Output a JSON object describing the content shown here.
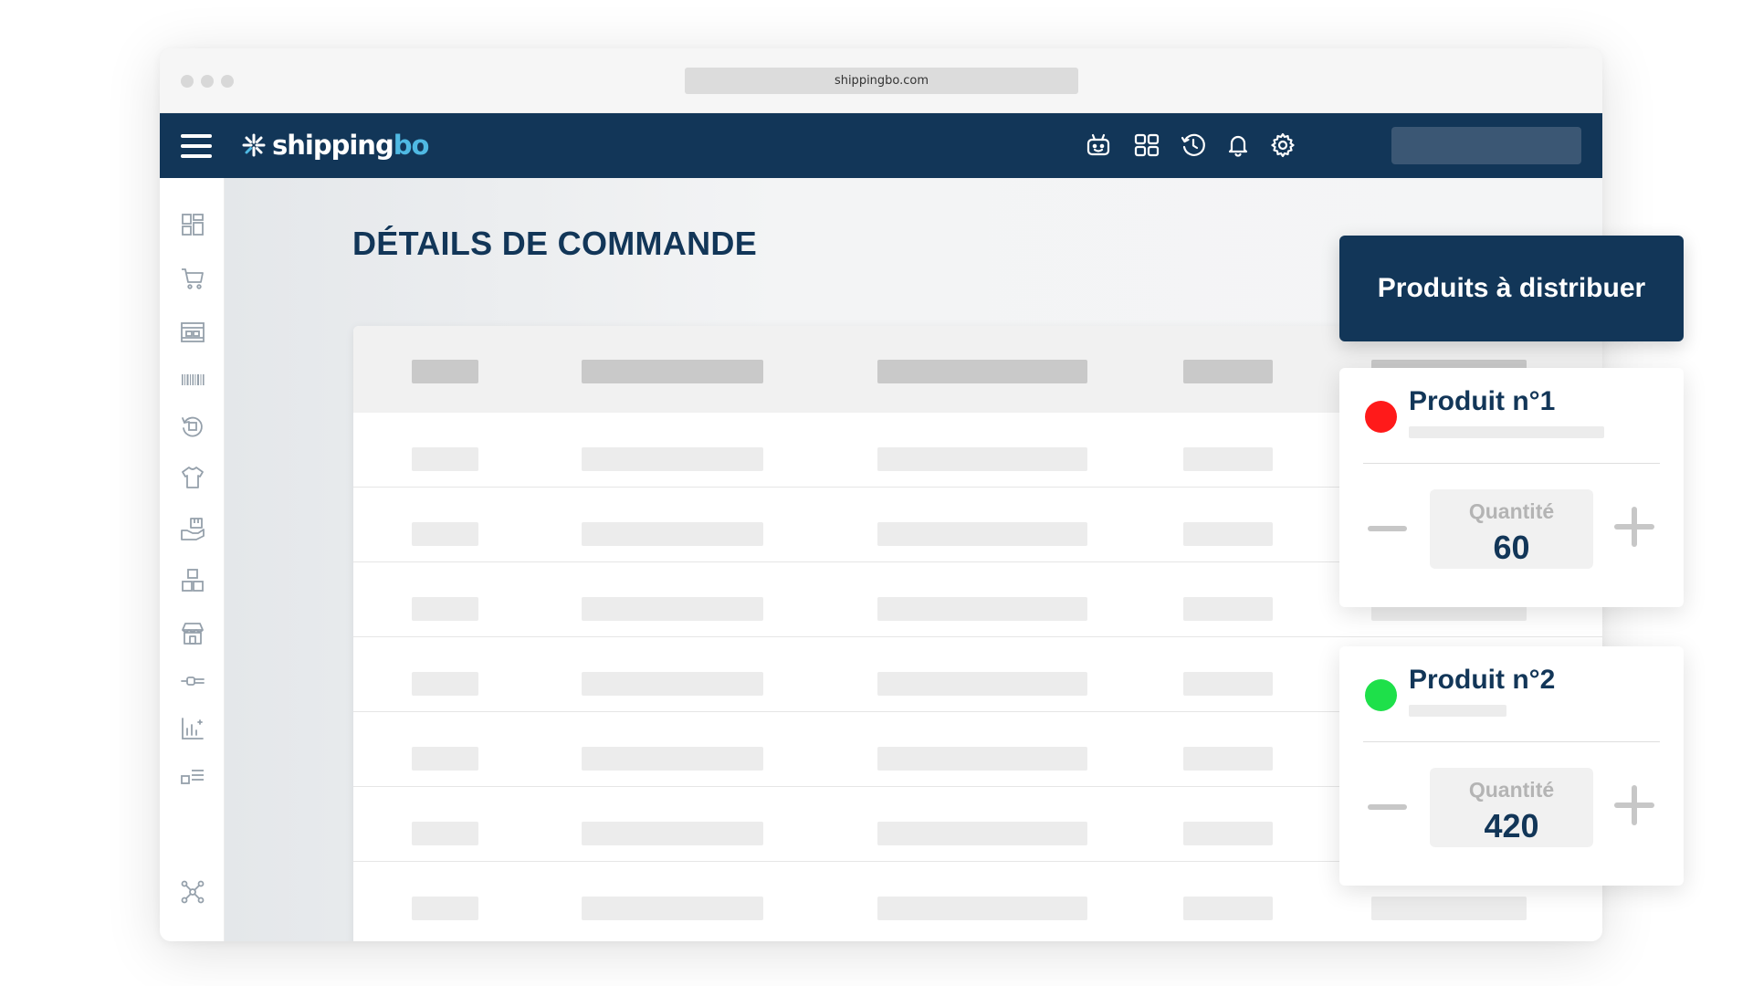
{
  "browser": {
    "url": "shippingbo.com"
  },
  "topnav": {
    "logo_main": "shipping",
    "logo_accent": "bo",
    "icons": [
      "robot-icon",
      "apps-grid-icon",
      "history-icon",
      "bell-icon",
      "gear-icon"
    ],
    "search_value": ""
  },
  "sidebar": {
    "items": [
      "dashboard-icon",
      "cart-icon",
      "warehouse-icon",
      "barcode-icon",
      "returns-icon",
      "tshirt-icon",
      "delivery-hand-icon",
      "boxes-icon",
      "store-icon",
      "connector-icon",
      "analytics-icon",
      "list-icon",
      "integrations-icon"
    ]
  },
  "page": {
    "title": "DÉTAILS DE COMMANDE"
  },
  "panel": {
    "title": "Produits à distribuer",
    "products": [
      {
        "name": "Produit n°1",
        "status_color": "#ff1a1a",
        "quantity_label": "Quantité",
        "quantity": "60"
      },
      {
        "name": "Produit n°2",
        "status_color": "#1ee04a",
        "quantity_label": "Quantité",
        "quantity": "420"
      }
    ]
  },
  "colors": {
    "brand_navy": "#123658",
    "brand_accent": "#4fb9e3"
  }
}
